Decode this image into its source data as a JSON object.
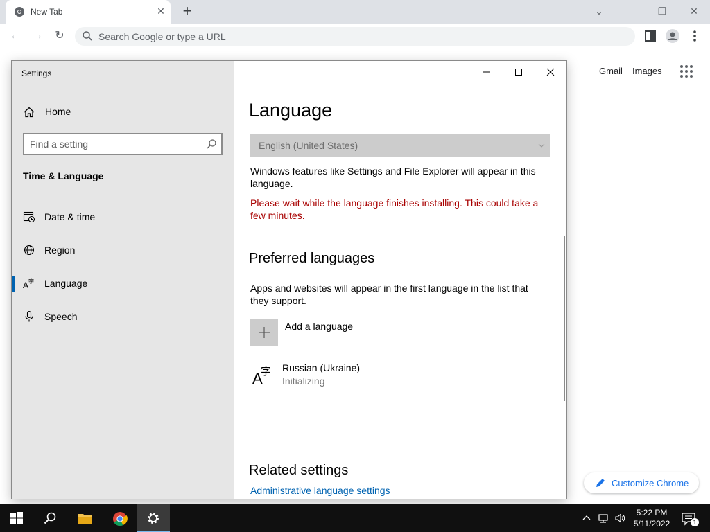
{
  "browser": {
    "tab_title": "New Tab",
    "omnibox_placeholder": "Search Google or type a URL",
    "ntp_links": [
      "Gmail",
      "Images"
    ],
    "customize_label": "Customize Chrome",
    "accent": "#1a73e8"
  },
  "settings": {
    "window_title": "Settings",
    "home_label": "Home",
    "search_placeholder": "Find a setting",
    "section_title": "Time & Language",
    "nav_items": [
      {
        "label": "Date & time",
        "icon": "calendar-clock-icon"
      },
      {
        "label": "Region",
        "icon": "globe-icon"
      },
      {
        "label": "Language",
        "icon": "language-icon",
        "active": true
      },
      {
        "label": "Speech",
        "icon": "microphone-icon"
      }
    ],
    "page_title": "Language",
    "display_language": "English (United States)",
    "display_language_desc": "Windows features like Settings and File Explorer will appear in this language.",
    "install_warning": "Please wait while the language finishes installing. This could take a few minutes.",
    "preferred_title": "Preferred languages",
    "preferred_desc": "Apps and websites will appear in the first language in the list that they support.",
    "add_language_label": "Add a language",
    "languages": [
      {
        "name": "Russian (Ukraine)",
        "status": "Initializing"
      }
    ],
    "related_title": "Related settings",
    "related_links": [
      "Administrative language settings"
    ],
    "accent": "#0063b1",
    "warning_color": "#a80000"
  },
  "taskbar": {
    "time": "5:22 PM",
    "date": "5/11/2022",
    "notification_count": "1"
  }
}
